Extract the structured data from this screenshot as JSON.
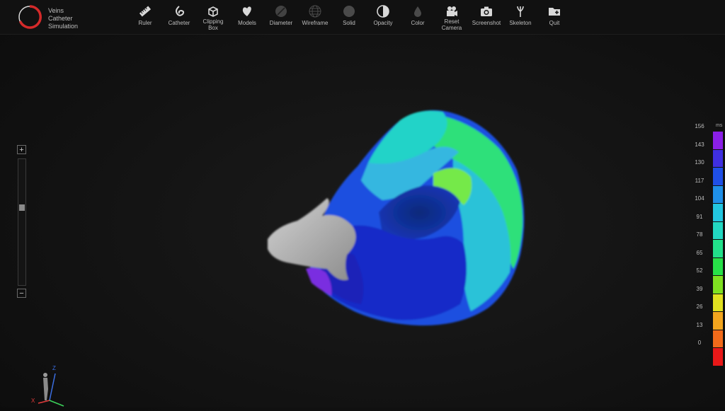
{
  "app": {
    "title_lines": [
      "Veins",
      "Catheter",
      "Simulation"
    ]
  },
  "toolbar": [
    {
      "name": "ruler",
      "label": "Ruler",
      "icon": "ruler-icon"
    },
    {
      "name": "catheter",
      "label": "Catheter",
      "icon": "catheter-icon"
    },
    {
      "name": "clipping-box",
      "label": "Clipping\nBox",
      "icon": "box-icon"
    },
    {
      "name": "models",
      "label": "Models",
      "icon": "heart-icon"
    },
    {
      "name": "diameter",
      "label": "Diameter",
      "icon": "diameter-icon"
    },
    {
      "name": "wireframe",
      "label": "Wireframe",
      "icon": "wireframe-icon"
    },
    {
      "name": "solid",
      "label": "Solid",
      "icon": "solid-icon"
    },
    {
      "name": "opacity",
      "label": "Opacity",
      "icon": "opacity-icon"
    },
    {
      "name": "color",
      "label": "Color",
      "icon": "droplet-icon"
    },
    {
      "name": "reset-camera",
      "label": "Reset\nCamera",
      "icon": "video-camera-icon"
    },
    {
      "name": "screenshot",
      "label": "Screenshot",
      "icon": "camera-icon"
    },
    {
      "name": "skeleton",
      "label": "Skeleton",
      "icon": "skeleton-icon"
    },
    {
      "name": "quit",
      "label": "Quit",
      "icon": "folder-exit-icon"
    }
  ],
  "zoom": {
    "plus": "+",
    "minus": "−",
    "level": 0.63
  },
  "color_scale": {
    "unit": "ms",
    "values": [
      "156",
      "143",
      "130",
      "117",
      "104",
      "91",
      "78",
      "65",
      "52",
      "39",
      "26",
      "13",
      "0"
    ],
    "colors": [
      "#8a1fe6",
      "#3f2fe0",
      "#1f4fe6",
      "#1f8fe8",
      "#22c6e0",
      "#22d8c2",
      "#22e08a",
      "#27e048",
      "#7fe021",
      "#e0e020",
      "#f2a51e",
      "#f26a1a",
      "#e81818"
    ]
  },
  "axes": {
    "x": "X",
    "z": "Z",
    "x_color": "#e23b3b",
    "z_color": "#3b6ee2",
    "y_color": "#3bd25a"
  }
}
